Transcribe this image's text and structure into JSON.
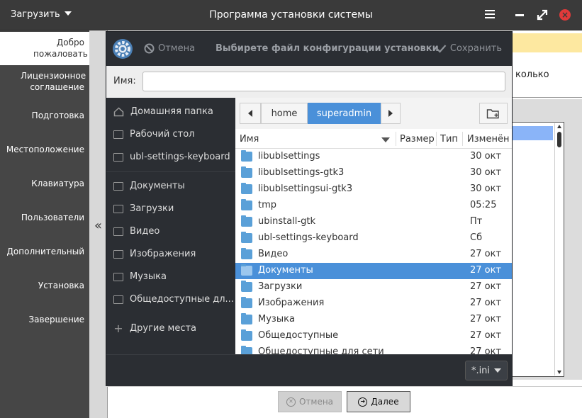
{
  "titlebar": {
    "load_label": "Загрузить",
    "title": "Программа установки системы",
    "close_glyph": "×"
  },
  "sidebar": {
    "items": [
      {
        "label": "Добро пожаловать"
      },
      {
        "label": "Лицензионное соглашение"
      },
      {
        "label": "Подготовка"
      },
      {
        "label": "Местоположение"
      },
      {
        "label": "Клавиатура"
      },
      {
        "label": "Пользователи"
      },
      {
        "label": "Дополнительный"
      },
      {
        "label": "Установка"
      },
      {
        "label": "Завершение"
      }
    ],
    "collapse_glyph": "«"
  },
  "background": {
    "partial_text": "колько"
  },
  "footer": {
    "cancel_label": "Отмена",
    "next_label": "Далее"
  },
  "dialog": {
    "cancel_label": "Отмена",
    "title": "Выбирете файл конфигурации установки",
    "save_label": "Сохранить",
    "name_label": "Имя:",
    "name_value": "",
    "places": [
      {
        "label": "Домашняя папка",
        "icon": "home-icon"
      },
      {
        "label": "Рабочий стол",
        "icon": "desktop-folder-icon"
      },
      {
        "label": "ubl-settings-keyboard",
        "icon": "folder-icon"
      },
      {
        "label": "Документы",
        "icon": "folder-icon"
      },
      {
        "label": "Загрузки",
        "icon": "folder-icon"
      },
      {
        "label": "Видео",
        "icon": "folder-icon"
      },
      {
        "label": "Изображения",
        "icon": "folder-icon"
      },
      {
        "label": "Музыка",
        "icon": "folder-icon"
      },
      {
        "label": "Общедоступные дл...",
        "icon": "folder-icon"
      },
      {
        "label": "Другие места",
        "icon": "plus-icon"
      }
    ],
    "path": [
      "home",
      "superadmin"
    ],
    "columns": {
      "name": "Имя",
      "size": "Размер",
      "type": "Тип",
      "modified": "Изменён"
    },
    "files": [
      {
        "name": "libublsettings",
        "modified": "30 окт"
      },
      {
        "name": "libublsettings-gtk3",
        "modified": "30 окт"
      },
      {
        "name": "libublsettingsui-gtk3",
        "modified": "30 окт"
      },
      {
        "name": "tmp",
        "modified": "05:25"
      },
      {
        "name": "ubinstall-gtk",
        "modified": "Пт"
      },
      {
        "name": "ubl-settings-keyboard",
        "modified": "Сб"
      },
      {
        "name": "Видео",
        "modified": "27 окт"
      },
      {
        "name": "Документы",
        "modified": "27 окт"
      },
      {
        "name": "Загрузки",
        "modified": "27 окт"
      },
      {
        "name": "Изображения",
        "modified": "27 окт"
      },
      {
        "name": "Музыка",
        "modified": "27 окт"
      },
      {
        "name": "Общедоступные",
        "modified": "27 окт"
      },
      {
        "name": "Общедоступные для сети",
        "modified": "27 окт"
      }
    ],
    "selected_index": 7,
    "filter": "*.ini",
    "colors": {
      "selection": "#4a90d9",
      "folder": "#5aa0d8",
      "dark_bg": "#2b2e33"
    }
  }
}
